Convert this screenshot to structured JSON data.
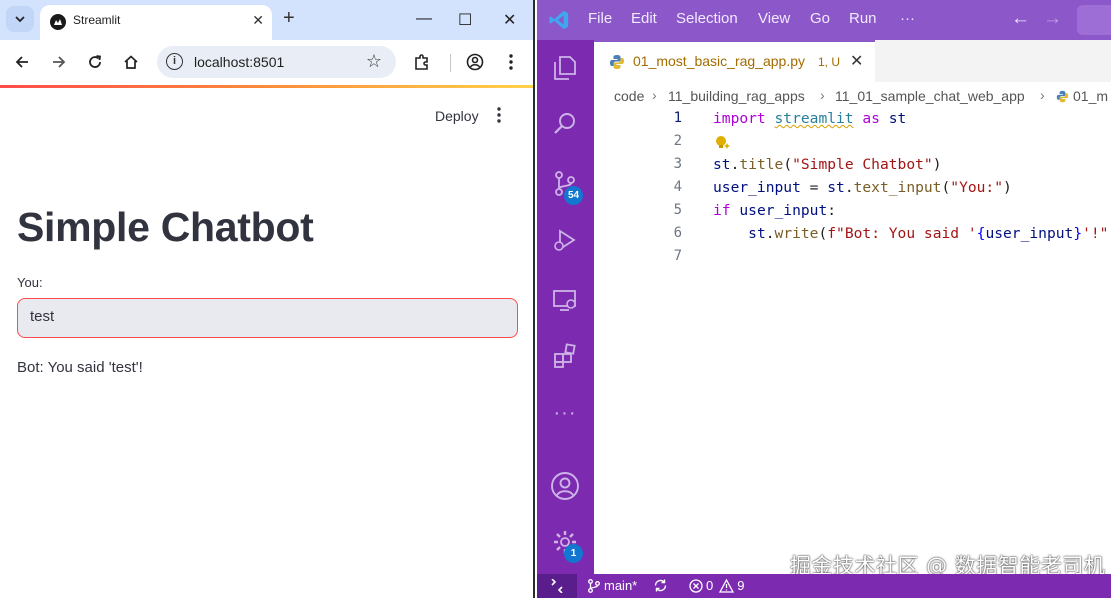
{
  "browser": {
    "tab_title": "Streamlit",
    "url": "localhost:8501",
    "window_controls": {
      "minimize": "—",
      "maximize": "☐",
      "close": "✕"
    },
    "new_tab": "+",
    "tab_close": "✕"
  },
  "streamlit": {
    "deploy_label": "Deploy",
    "title": "Simple Chatbot",
    "input_label": "You:",
    "input_value": "test",
    "output": "Bot: You said 'test'!"
  },
  "vscode": {
    "menu": [
      "File",
      "Edit",
      "Selection",
      "View",
      "Go",
      "Run",
      "···"
    ],
    "tab": {
      "filename": "01_most_basic_rag_app.py",
      "status": "1, U"
    },
    "breadcrumbs": [
      "code",
      "11_building_rag_apps",
      "11_01_sample_chat_web_app",
      "01_m"
    ],
    "line_numbers": [
      "1",
      "2",
      "3",
      "4",
      "5",
      "6",
      "7"
    ],
    "code": {
      "l1": {
        "k1": "import",
        "m": "streamlit",
        "k2": "as",
        "v": "st"
      },
      "l3": {
        "v": "st",
        "p1": ".",
        "f": "title",
        "p2": "(",
        "s": "\"Simple Chatbot\"",
        "p3": ")"
      },
      "l4": {
        "v1": "user_input",
        "op": " = ",
        "v2": "st",
        "p1": ".",
        "f": "text_input",
        "p2": "(",
        "s": "\"You:\"",
        "p3": ")"
      },
      "l5": {
        "k": "if",
        "v": "user_input",
        "p": ":"
      },
      "l6": {
        "indent": "    ",
        "v": "st",
        "p1": ".",
        "f": "write",
        "p2": "(",
        "s1": "f\"Bot: You said '",
        "b1": "{",
        "v2": "user_input",
        "b2": "}",
        "s2": "'!\"",
        "p3": ")"
      }
    },
    "badges": {
      "source_control": "54",
      "settings": "1"
    },
    "status_bar": {
      "branch": "main*",
      "errors": "0",
      "warnings": "9"
    },
    "watermark": "掘金技术社区 @ 数据智能老司机"
  },
  "colors": {
    "vscode_purple": "#8b57c9",
    "activity_bar": "#7c2bb0",
    "streamlit_red": "#ff4b4b",
    "chrome_blue": "#d3e3fd"
  }
}
